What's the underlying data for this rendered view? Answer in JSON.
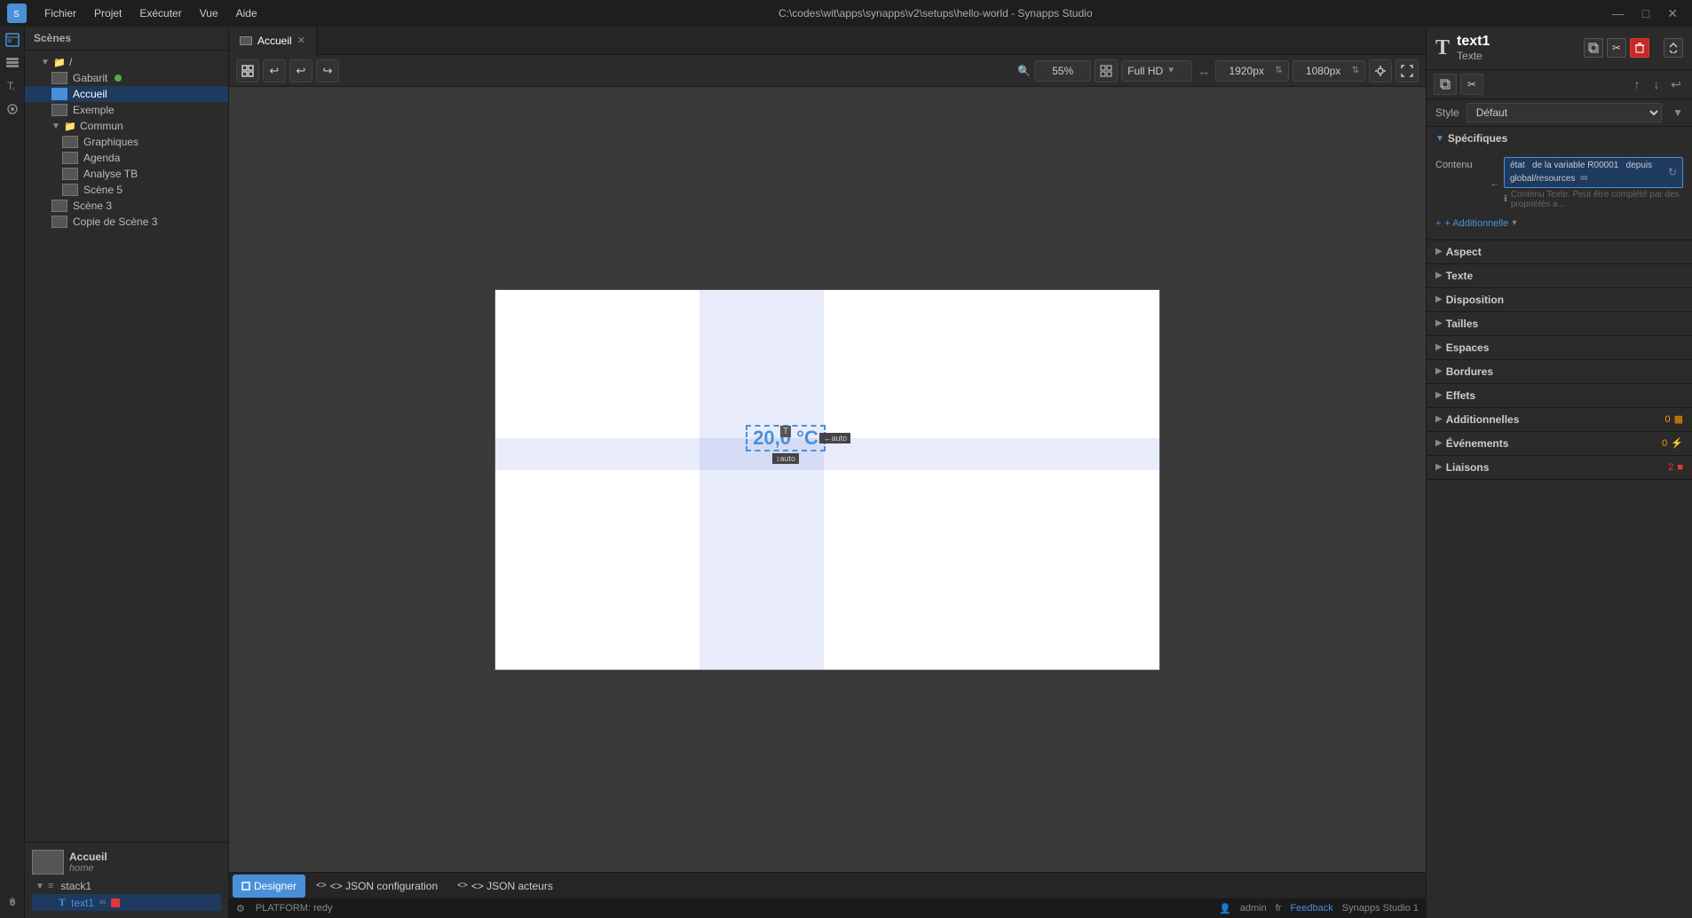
{
  "window": {
    "title": "C:\\codes\\wit\\apps\\synapps\\v2\\setups\\hello-world - Synapps Studio"
  },
  "menubar": {
    "logo": "S",
    "items": [
      "Fichier",
      "Projet",
      "Exécuter",
      "Vue",
      "Aide"
    ]
  },
  "sidebar": {
    "header": "Scènes",
    "tree": [
      {
        "id": "root",
        "label": "/",
        "type": "folder",
        "indent": 0,
        "expanded": true
      },
      {
        "id": "gabarit",
        "label": "Gabarit",
        "type": "scene",
        "indent": 1,
        "badge": "green"
      },
      {
        "id": "accueil",
        "label": "Accueil",
        "type": "scene",
        "indent": 1,
        "selected": true
      },
      {
        "id": "exemple",
        "label": "Exemple",
        "type": "scene",
        "indent": 1
      },
      {
        "id": "commun",
        "label": "Commun",
        "type": "folder",
        "indent": 1,
        "expanded": true
      },
      {
        "id": "graphiques",
        "label": "Graphiques",
        "type": "scene",
        "indent": 2
      },
      {
        "id": "agenda",
        "label": "Agenda",
        "type": "scene",
        "indent": 2
      },
      {
        "id": "analysetb",
        "label": "Analyse TB",
        "type": "scene",
        "indent": 2
      },
      {
        "id": "scene5",
        "label": "Scène 5",
        "type": "scene",
        "indent": 2
      },
      {
        "id": "scene3",
        "label": "Scène 3",
        "type": "scene",
        "indent": 1
      },
      {
        "id": "copie-scene3",
        "label": "Copie de Scène 3",
        "type": "scene",
        "indent": 1
      }
    ],
    "preview": {
      "name": "Accueil",
      "sub": "home"
    },
    "layer_tree": {
      "stack": "stack1",
      "child": "text1"
    }
  },
  "tabs": [
    {
      "id": "accueil",
      "label": "Accueil",
      "active": true,
      "closable": true
    }
  ],
  "toolbar": {
    "zoom_icon": "🔍",
    "zoom_value": "55%",
    "resolution_label": "Full HD",
    "width_value": "1920px",
    "height_value": "1080px"
  },
  "canvas": {
    "selected_text": "20,0 °C",
    "handle_label": "T",
    "resize_right": "←auto",
    "resize_bottom": "↕auto"
  },
  "bottom_tabs": [
    {
      "id": "designer",
      "label": "Designer",
      "active": true
    },
    {
      "id": "json-config",
      "label": "<> JSON configuration",
      "active": false
    },
    {
      "id": "json-acteurs",
      "label": "<> JSON acteurs",
      "active": false
    }
  ],
  "statusbar": {
    "left": "PLATFORM: redy",
    "user": "admin",
    "language": "fr",
    "feedback": "Feedback",
    "version": "Synapps Studio 1"
  },
  "rightpanel": {
    "element_name": "text1",
    "element_type": "Texte",
    "style_label": "Style",
    "style_value": "Défaut",
    "sections": [
      {
        "id": "specifiques",
        "label": "Spécifiques",
        "expanded": true
      },
      {
        "id": "aspect",
        "label": "Aspect",
        "expanded": false
      },
      {
        "id": "texte",
        "label": "Texte",
        "expanded": false
      },
      {
        "id": "disposition",
        "label": "Disposition",
        "expanded": false
      },
      {
        "id": "tailles",
        "label": "Tailles",
        "expanded": false
      },
      {
        "id": "espaces",
        "label": "Espaces",
        "expanded": false
      },
      {
        "id": "bordures",
        "label": "Bordures",
        "expanded": false
      },
      {
        "id": "effets",
        "label": "Effets",
        "expanded": false
      },
      {
        "id": "additionnelles",
        "label": "Additionnelles",
        "expanded": false,
        "badge": "0"
      },
      {
        "id": "evenements",
        "label": "Événements",
        "expanded": false,
        "badge": "0"
      },
      {
        "id": "liaisons",
        "label": "Liaisons",
        "expanded": false,
        "badge": "2"
      }
    ],
    "contenu": {
      "label": "Contenu",
      "binding_state": "état",
      "binding_variable": "de la variable R00001",
      "binding_from": "depuis",
      "binding_path": "global/resources",
      "note": "Contenu Texte. Peut être complété par des propriétés a..."
    },
    "add_additional": "+ Additionnelle"
  }
}
